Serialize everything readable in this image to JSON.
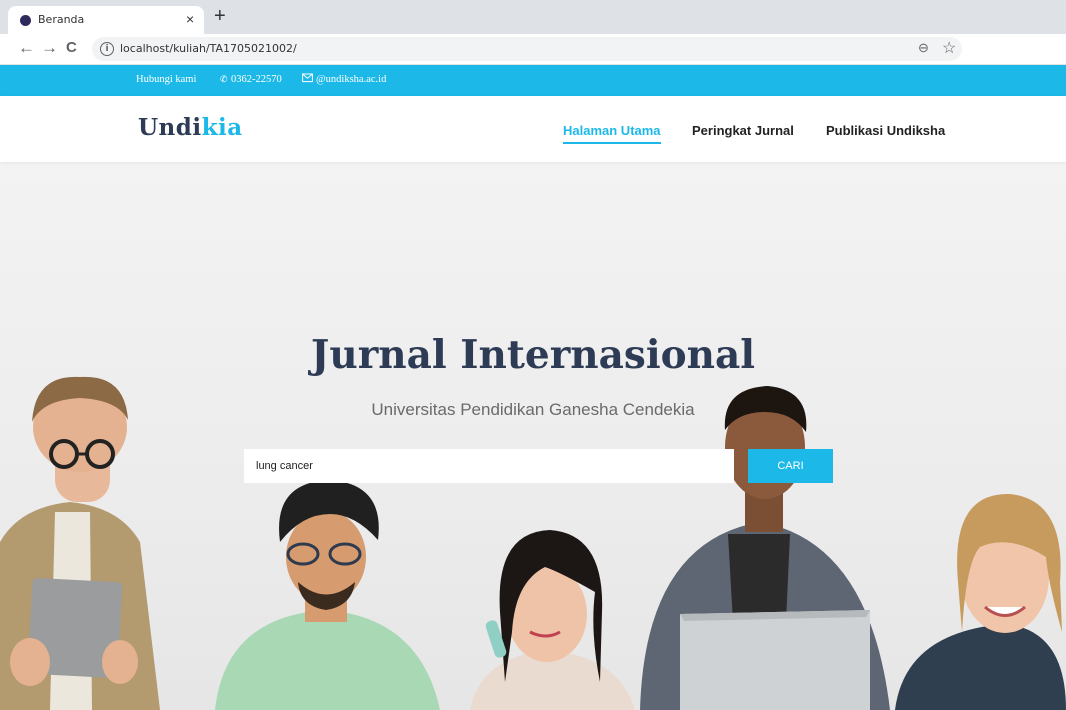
{
  "browser": {
    "tab_title": "Beranda",
    "tab_close": "×",
    "new_tab": "+",
    "url": "localhost/kuliah/TA1705021002/",
    "back": "←",
    "forward": "→",
    "reload": "C",
    "info_icon": "i",
    "zoom_icon": "⊖",
    "star_icon": "☆"
  },
  "topbar": {
    "contact_label": "Hubungi kami",
    "phone_icon": "phone-icon",
    "phone": "0362-22570",
    "email_icon": "envelope-icon",
    "email": "@undiksha.ac.id"
  },
  "header": {
    "logo_part1": "Undi",
    "logo_part2": "kia",
    "nav": [
      {
        "label": "Halaman Utama",
        "active": true
      },
      {
        "label": "Peringkat Jurnal",
        "active": false
      },
      {
        "label": "Publikasi Undiksha",
        "active": false
      }
    ]
  },
  "hero": {
    "title": "Jurnal Internasional",
    "subtitle": "Universitas Pendidikan Ganesha Cendekia",
    "search_value": "lung cancer",
    "search_button": "CARI"
  },
  "colors": {
    "accent": "#1cb9e8",
    "dark": "#2d3b55"
  }
}
